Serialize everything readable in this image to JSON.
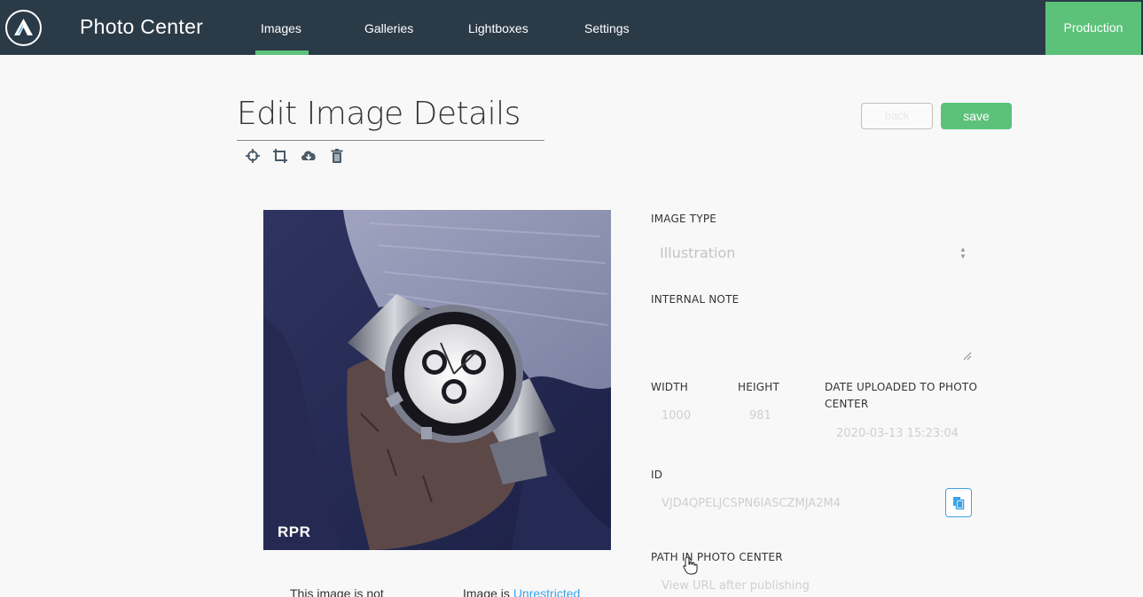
{
  "app": {
    "title": "Photo Center",
    "environment": "Production"
  },
  "nav": {
    "items": [
      {
        "label": "Images",
        "active": true
      },
      {
        "label": "Galleries",
        "active": false
      },
      {
        "label": "Lightboxes",
        "active": false
      },
      {
        "label": "Settings",
        "active": false
      }
    ]
  },
  "page": {
    "title": "Edit Image Details",
    "back_label": "back",
    "save_label": "save",
    "tools": [
      "crosshair-icon",
      "crop-icon",
      "cloud-download-icon",
      "trash-icon"
    ]
  },
  "image": {
    "watermark": "RPR"
  },
  "bottom": {
    "note_left": "This image is not",
    "note_right_prefix": "Image is",
    "note_right_link": "Unrestricted"
  },
  "form": {
    "image_type_label": "IMAGE TYPE",
    "image_type_value": "Illustration",
    "internal_note_label": "INTERNAL NOTE",
    "internal_note_value": "",
    "width_label": "WIDTH",
    "width_value": "1000",
    "height_label": "HEIGHT",
    "height_value": "981",
    "date_label_line1": "DATE UPLOADED TO PHOTO",
    "date_label_line2": "CENTER",
    "date_value": "2020-03-13 15:23:04",
    "id_label": "ID",
    "id_value": "VJD4QPELJCSPN6IASCZMJA2M4",
    "path_label": "PATH IN PHOTO CENTER",
    "path_value": "View URL after publishing"
  },
  "colors": {
    "topbar": "#2b3a47",
    "accent_green": "#5cc27a",
    "link_blue": "#3ba3e6"
  }
}
